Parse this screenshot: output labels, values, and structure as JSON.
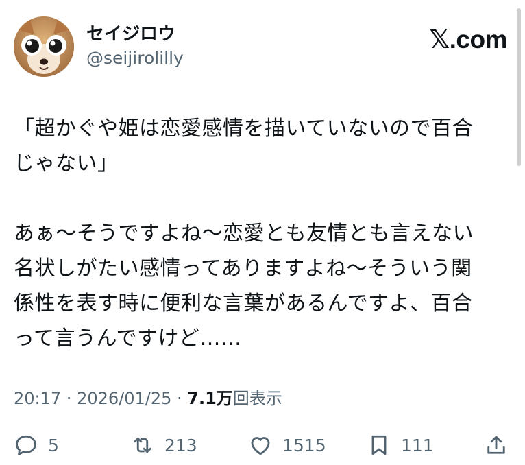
{
  "author": {
    "display_name": "セイジロウ",
    "handle": "@seijirolilly"
  },
  "brand": {
    "label": "𝕏.com"
  },
  "post": {
    "paragraph1": [
      "「超かぐや姫は恋愛感情を描いていないので百合",
      "じゃない」"
    ],
    "paragraph2": [
      "あぁ～そうですよね～恋愛とも友情とも言えない",
      "名状しがたい感情ってありますよね～そういう関",
      "係性を表す時に便利な言葉があるんですよ、百合",
      "って言うんですけど……"
    ]
  },
  "meta": {
    "time": "20:17",
    "separator": " · ",
    "date": "2026/01/25",
    "views_count": "7.1万",
    "views_label": "回表示"
  },
  "actions": {
    "reply_count": "5",
    "repost_count": "213",
    "like_count": "1515",
    "bookmark_count": "111"
  },
  "colors": {
    "text": "#0f1419",
    "secondary": "#536471"
  },
  "icons": [
    "reply-icon",
    "repost-icon",
    "like-icon",
    "bookmark-icon",
    "share-icon"
  ]
}
